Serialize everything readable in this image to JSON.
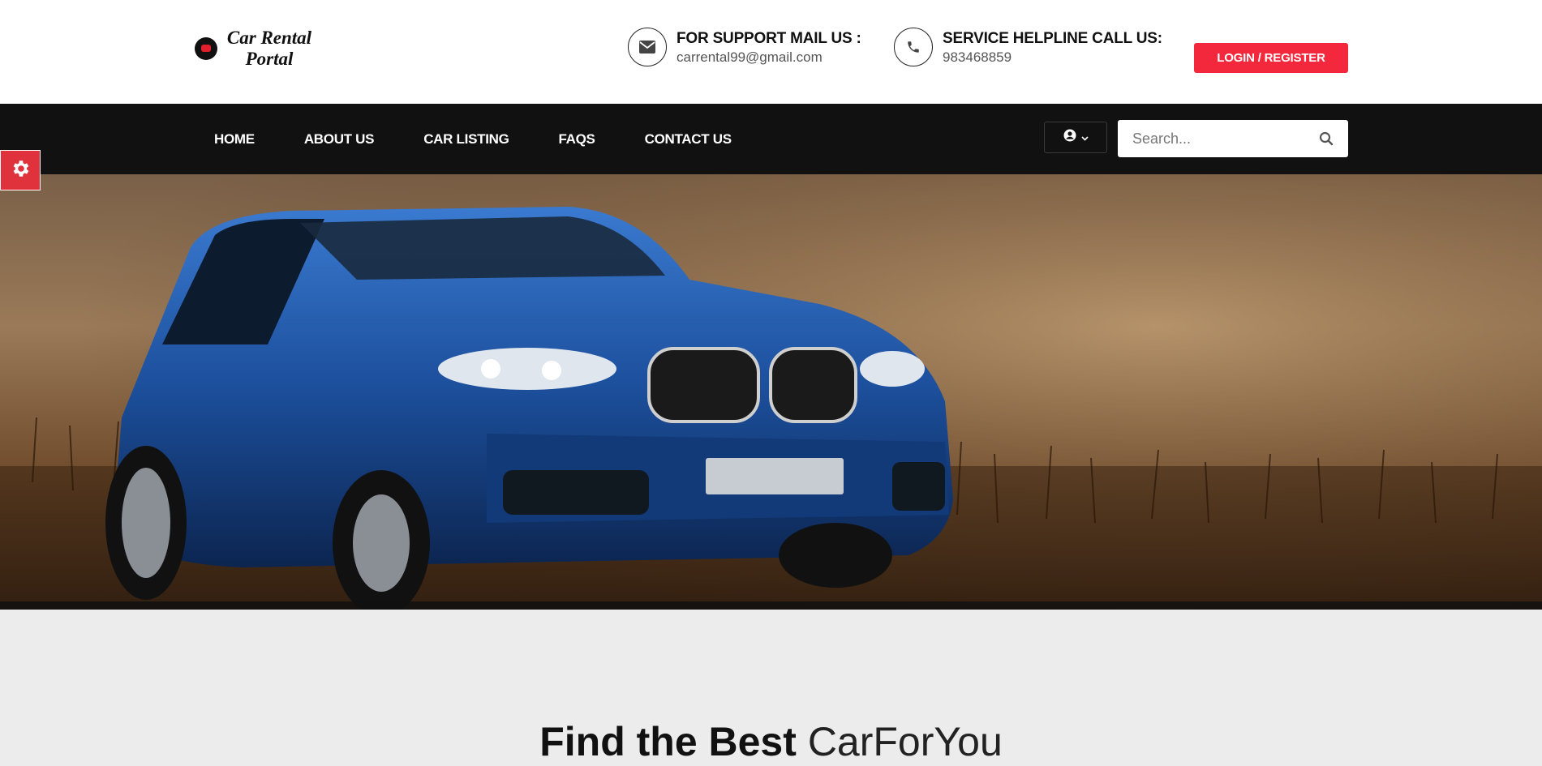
{
  "brand": {
    "name_line1": "Car Rental",
    "name_line2": "Portal"
  },
  "contacts": {
    "mail": {
      "icon": "envelope-icon",
      "title": "FOR SUPPORT MAIL US :",
      "value": "carrental99@gmail.com"
    },
    "phone": {
      "icon": "phone-icon",
      "title": "SERVICE HELPLINE CALL US:",
      "value": "983468859"
    }
  },
  "login_button": "LOGIN / REGISTER",
  "nav": {
    "items": [
      "HOME",
      "ABOUT US",
      "CAR LISTING",
      "FAQS",
      "CONTACT US"
    ],
    "user_menu_icon": "user-circle-icon",
    "search_placeholder": "Search..."
  },
  "settings_icon": "gear-icon",
  "hero": {
    "image_subject": "blue SUV in dusty field"
  },
  "headline": {
    "bold": "Find the Best",
    "light": "CarForYou"
  },
  "colors": {
    "accent": "#f3283c",
    "nav_bg": "#111111",
    "page_bg": "#ececec",
    "car_blue": "#1c4f9c"
  }
}
